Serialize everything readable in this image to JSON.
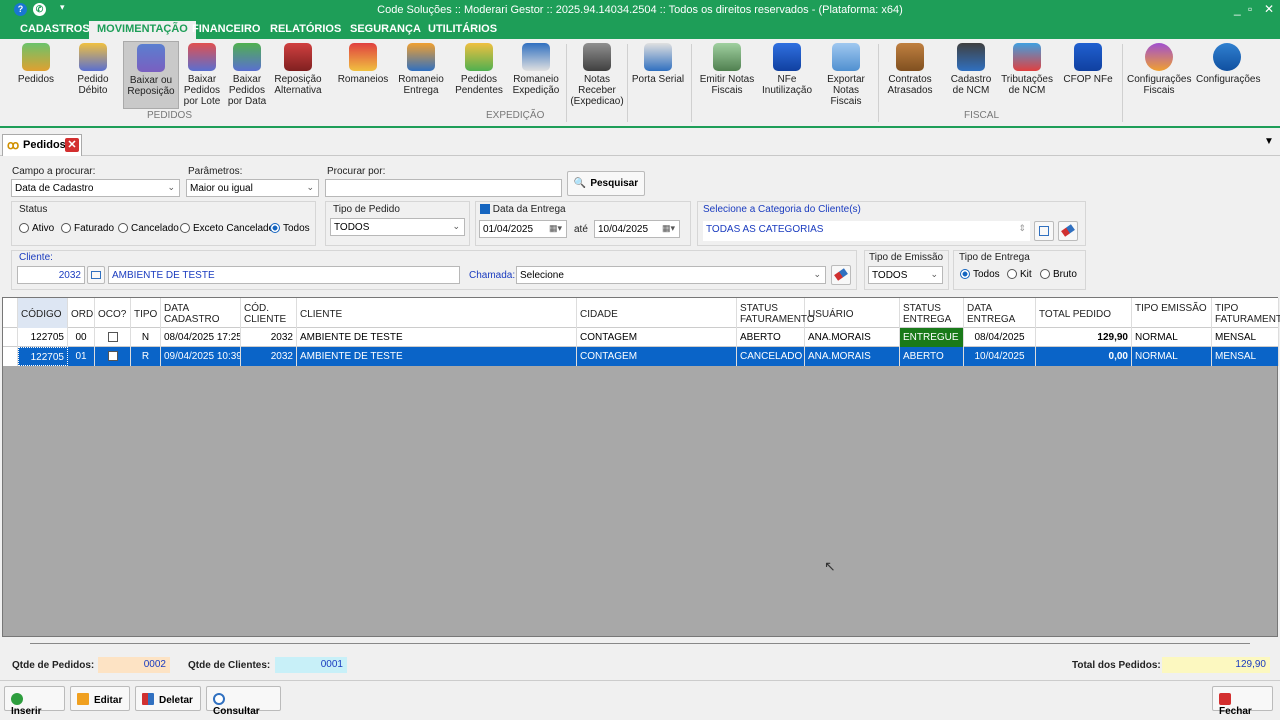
{
  "window": {
    "title": "Code Soluções :: Moderari Gestor :: 2025.94.14034.2504 :: Todos os direitos reservados - (Plataforma: x64)"
  },
  "menu": [
    "CADASTROS",
    "MOVIMENTAÇÃO",
    "FINANCEIRO",
    "RELATÓRIOS",
    "SEGURANÇA",
    "UTILITÁRIOS"
  ],
  "ribbon": {
    "buttons": [
      "Pedidos",
      "Pedido Débito",
      "Baixar ou Reposição",
      "Baixar Pedidos por Lote",
      "Baixar Pedidos por Data",
      "Reposição Alternativa",
      "Romaneios",
      "Romaneio Entrega",
      "Pedidos Pendentes",
      "Romaneio Expedição",
      "Notas Receber (Expedicao)",
      "Porta Serial",
      "Emitir Notas Fiscais",
      "NFe Inutilização",
      "Exportar Notas Fiscais",
      "Contratos Atrasados",
      "Cadastro de NCM",
      "Tributações de NCM",
      "CFOP NFe",
      "Configurações Fiscais",
      "Configurações"
    ],
    "groups": [
      "PEDIDOS",
      "EXPEDIÇÃO",
      "FISCAL"
    ]
  },
  "tab": {
    "label": "Pedidos"
  },
  "filters": {
    "campo_label": "Campo a procurar:",
    "campo_value": "Data de Cadastro",
    "param_label": "Parâmetros:",
    "param_value": "Maior ou igual",
    "procurar_label": "Procurar por:",
    "procurar_value": "",
    "pesquisar": "Pesquisar",
    "status_label": "Status",
    "status_options": [
      "Ativo",
      "Faturado",
      "Cancelado",
      "Exceto Cancelado",
      "Todos"
    ],
    "tipo_pedido_label": "Tipo de Pedido",
    "tipo_pedido_value": "TODOS",
    "data_entrega_label": "Data da Entrega",
    "data_de": "01/04/2025",
    "ate": "até",
    "data_ate": "10/04/2025",
    "categoria_label": "Selecione a Categoria do Cliente(s)",
    "categoria_value": "TODAS AS CATEGORIAS",
    "cliente_label": "Cliente:",
    "cliente_code": "2032",
    "cliente_name": "AMBIENTE DE TESTE",
    "chamada_label": "Chamada:",
    "chamada_value": "Selecione",
    "tipo_emissao_label": "Tipo de Emissão",
    "tipo_emissao_value": "TODOS",
    "tipo_entrega_label": "Tipo de Entrega",
    "tipo_entrega_options": [
      "Todos",
      "Kit",
      "Bruto"
    ]
  },
  "grid": {
    "headers": [
      "CÓDIGO",
      "ORD",
      "OCO?",
      "TIPO",
      "DATA CADASTRO",
      "CÓD. CLIENTE",
      "CLIENTE",
      "CIDADE",
      "STATUS FATURAMENTO",
      "USUÁRIO",
      "STATUS ENTREGA",
      "DATA ENTREGA",
      "TOTAL PEDIDO",
      "TIPO EMISSÃO",
      "TIPO FATURAMENTO"
    ],
    "rows": [
      [
        "122705",
        "00",
        "",
        "N",
        "08/04/2025 17:25",
        "2032",
        "AMBIENTE DE TESTE",
        "CONTAGEM",
        "ABERTO",
        "ANA.MORAIS",
        "ENTREGUE",
        "08/04/2025",
        "129,90",
        "NORMAL",
        "MENSAL"
      ],
      [
        "122705",
        "01",
        "",
        "R",
        "09/04/2025 10:39",
        "2032",
        "AMBIENTE DE TESTE",
        "CONTAGEM",
        "CANCELADO",
        "ANA.MORAIS",
        "ABERTO",
        "10/04/2025",
        "0,00",
        "NORMAL",
        "MENSAL"
      ]
    ],
    "entregue_color": "#1a7a1a"
  },
  "footer": {
    "qtd_pedidos_label": "Qtde de Pedidos:",
    "qtd_pedidos": "0002",
    "qtd_clientes_label": "Qtde de Clientes:",
    "qtd_clientes": "0001",
    "total_label": "Total dos Pedidos:",
    "total": "129,90"
  },
  "actions": {
    "inserir": "Inserir",
    "editar": "Editar",
    "deletar": "Deletar",
    "consultar": "Consultar",
    "fechar": "Fechar"
  }
}
